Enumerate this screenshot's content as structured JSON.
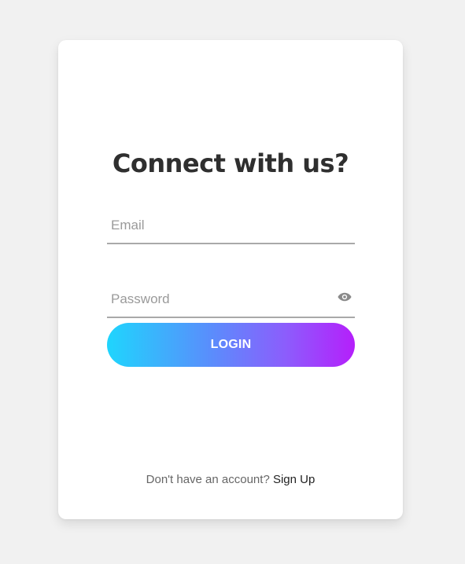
{
  "login_card": {
    "title": "Connect with us?",
    "email_placeholder": "Email",
    "password_placeholder": "Password",
    "password_toggle_icon": "eye-icon",
    "login_button_label": "LOGIN",
    "footer_text": "Don't have an account?",
    "signup_link": "Sign Up"
  },
  "colors": {
    "page_background": "#f1f1f1",
    "card_background": "#ffffff",
    "title_text": "#2f2f2f",
    "gradient_start": "#1fd5fd",
    "gradient_end": "#b51ffb"
  }
}
